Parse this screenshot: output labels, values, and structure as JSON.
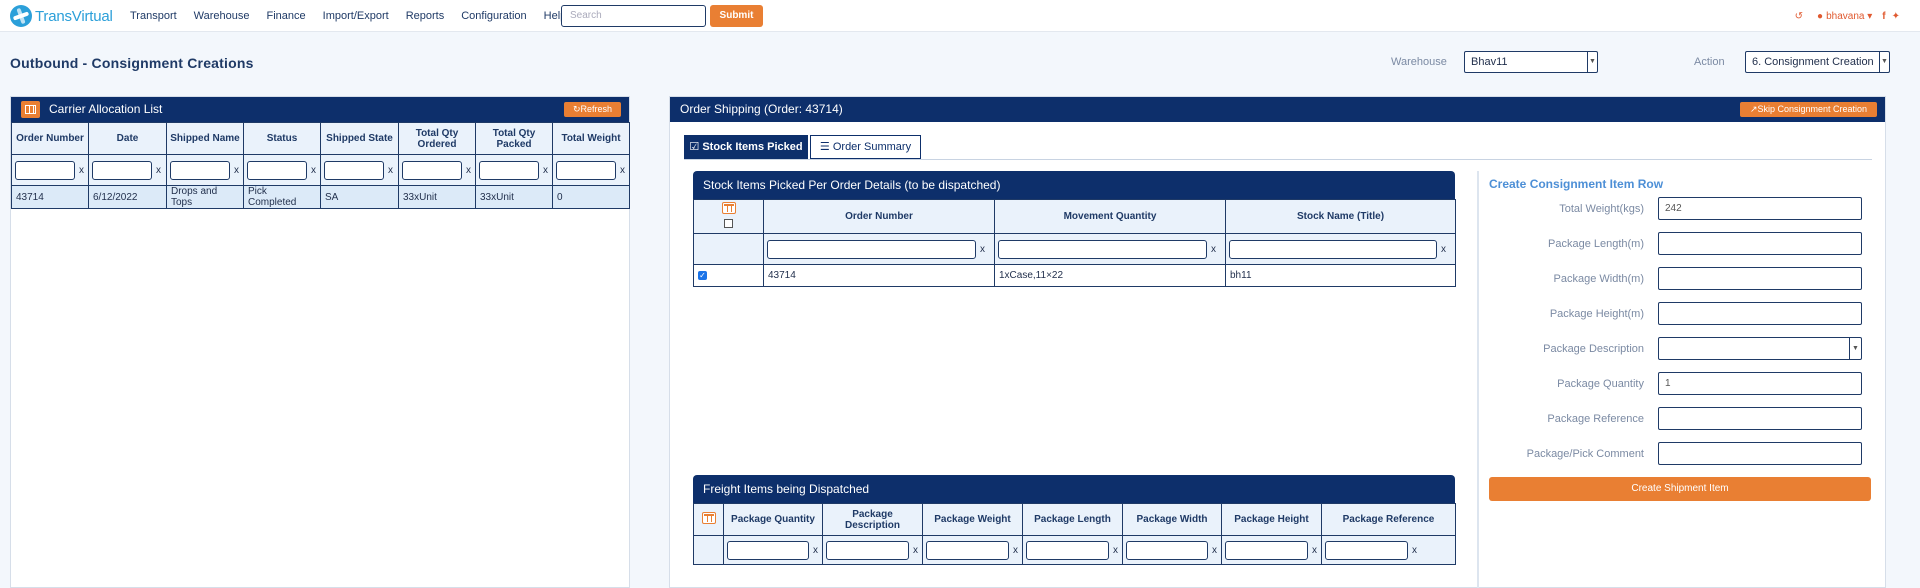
{
  "nav": {
    "brand": "TransVirtual",
    "menu": [
      "Transport",
      "Warehouse",
      "Finance",
      "Import/Export",
      "Reports",
      "Configuration",
      "Help"
    ],
    "search_placeholder": "Search",
    "submit_label": "Submit",
    "user": "bhavana"
  },
  "page": {
    "title": "Outbound - Consignment Creations"
  },
  "filters": {
    "warehouse_label": "Warehouse",
    "warehouse_value": "Bhav11",
    "action_label": "Action",
    "action_value": "6. Consignment Creation"
  },
  "carrier_list": {
    "title": "Carrier Allocation List",
    "refresh_label": "Refresh",
    "columns": [
      "Order Number",
      "Date",
      "Shipped Name",
      "Status",
      "Shipped State",
      "Total Qty Ordered",
      "Total Qty Packed",
      "Total Weight"
    ],
    "rows": [
      [
        "43714",
        "6/12/2022",
        "Drops and Tops",
        "Pick Completed",
        "SA",
        "33xUnit",
        "33xUnit",
        "0"
      ]
    ]
  },
  "order_shipping": {
    "title": "Order Shipping (Order: 43714)",
    "skip_label": "Skip Consignment Creation",
    "tabs": [
      "Stock Items Picked",
      "Order Summary"
    ]
  },
  "stock_items": {
    "title": "Stock Items Picked Per Order Details (to be dispatched)",
    "columns": [
      "Order Number",
      "Movement Quantity",
      "Stock Name (Title)"
    ],
    "rows": [
      [
        "43714",
        "1xCase,11×22",
        "bh11"
      ]
    ]
  },
  "freight": {
    "title": "Freight Items being Dispatched",
    "columns": [
      "Package Quantity",
      "Package Description",
      "Package Weight",
      "Package Length",
      "Package Width",
      "Package Height",
      "Package Reference"
    ]
  },
  "consignment_form": {
    "title": "Create Consignment Item Row",
    "fields": [
      {
        "label": "Total Weight(kgs)",
        "value": "242"
      },
      {
        "label": "Package Length(m)",
        "value": ""
      },
      {
        "label": "Package Width(m)",
        "value": ""
      },
      {
        "label": "Package Height(m)",
        "value": ""
      },
      {
        "label": "Package Description",
        "value": ""
      },
      {
        "label": "Package Quantity",
        "value": "1"
      },
      {
        "label": "Package Reference",
        "value": ""
      },
      {
        "label": "Package/Pick Comment",
        "value": ""
      }
    ],
    "create_label": "Create Shipment Item"
  },
  "colors": {
    "navy": "#0d2f6b",
    "orange": "#e97f33",
    "link_blue": "#4d8fd6"
  },
  "icons": [
    "globe-icon",
    "history-icon",
    "user-icon",
    "facebook-icon",
    "twitter-icon",
    "refresh-icon",
    "columns-icon",
    "check-square-icon",
    "list-icon",
    "external-link-icon"
  ]
}
